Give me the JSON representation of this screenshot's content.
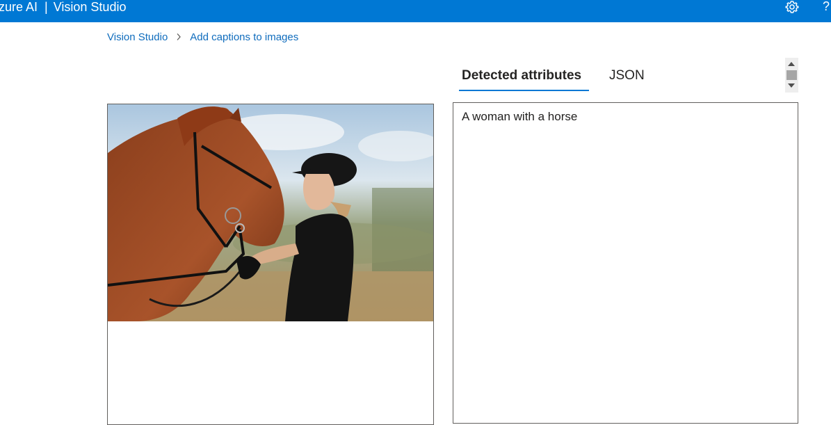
{
  "app": {
    "brand": "zure AI",
    "separator": "|",
    "product": "Vision Studio",
    "help_label": "?"
  },
  "breadcrumb": {
    "items": [
      "Vision Studio",
      "Add captions to images"
    ]
  },
  "tabs": [
    {
      "label": "Detected attributes",
      "active": true
    },
    {
      "label": "JSON",
      "active": false
    }
  ],
  "result": {
    "caption": "A woman with a horse"
  },
  "colors": {
    "header": "#0078d4",
    "link": "#0f6cbd",
    "tab_indicator": "#0078d4"
  },
  "icons": {
    "settings": "gear-icon",
    "breadcrumb_separator": "chevron-right-icon"
  }
}
